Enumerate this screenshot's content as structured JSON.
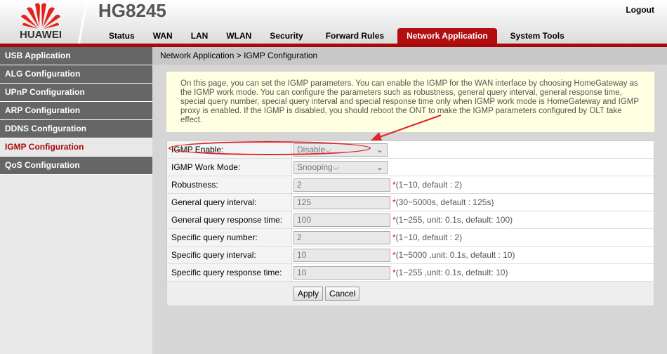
{
  "header": {
    "brand": "HUAWEI",
    "model": "HG8245",
    "logout": "Logout",
    "tabs": [
      "Status",
      "WAN",
      "LAN",
      "WLAN",
      "Security",
      "Forward Rules",
      "Network Application",
      "System Tools"
    ],
    "active_tab": "Network Application"
  },
  "sidebar": {
    "items": [
      "USB Application",
      "ALG Configuration",
      "UPnP Configuration",
      "ARP Configuration",
      "DDNS Configuration",
      "IGMP Configuration",
      "QoS Configuration"
    ],
    "active": "IGMP Configuration"
  },
  "breadcrumb": "Network Application > IGMP Configuration",
  "info": "On this page, you can set the IGMP parameters. You can enable the IGMP for the WAN interface by choosing HomeGateway as the IGMP work mode. You can configure the parameters such as robustness, general query interval, general response time, special query number, special query interval and special response time only when IGMP work mode is HomeGateway and IGMP proxy is enabled. If the IGMP is disabled, you should reboot the ONT to make the IGMP parameters configured by OLT take effect.",
  "form": {
    "igmp_enable": {
      "label": "IGMP Enable:",
      "value": "Disable"
    },
    "work_mode": {
      "label": "IGMP Work Mode:",
      "value": "Snooping"
    },
    "fields": [
      {
        "label": "Robustness:",
        "value": "2",
        "hint": "(1~10, default : 2)"
      },
      {
        "label": "General query interval:",
        "value": "125",
        "hint": "(30~5000s, default : 125s)"
      },
      {
        "label": "General query response time:",
        "value": "100",
        "hint": "(1~255, unit: 0.1s, default: 100)"
      },
      {
        "label": "Specific query number:",
        "value": "2",
        "hint": "(1~10, default : 2)"
      },
      {
        "label": "Specific query interval:",
        "value": "10",
        "hint": "(1~5000 ,unit: 0.1s, default : 10)"
      },
      {
        "label": "Specific query response time:",
        "value": "10",
        "hint": "(1~255 ,unit: 0.1s, default: 10)"
      }
    ],
    "apply": "Apply",
    "cancel": "Cancel"
  },
  "colors": {
    "brand_red": "#a8090b",
    "annotation_red": "#e0262a"
  }
}
